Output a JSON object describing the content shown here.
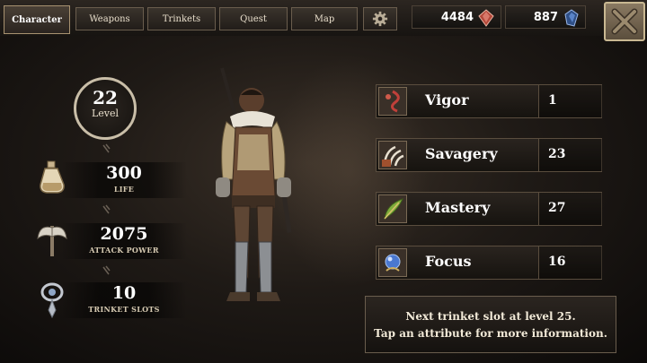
{
  "tabs": [
    {
      "label": "Character",
      "active": true
    },
    {
      "label": "Weapons",
      "active": false
    },
    {
      "label": "Trinkets",
      "active": false
    },
    {
      "label": "Quest",
      "active": false
    },
    {
      "label": "Map",
      "active": false
    }
  ],
  "settings_icon": "gear-icon",
  "currencies": [
    {
      "value": "4484",
      "icon": "red-gem-icon"
    },
    {
      "value": "887",
      "icon": "blue-gem-icon"
    }
  ],
  "close_icon": "close-x-icon",
  "level": {
    "value": "22",
    "label": "Level"
  },
  "stats": [
    {
      "value": "300",
      "label": "LIFE",
      "icon": "potion-flask-icon"
    },
    {
      "value": "2075",
      "label": "ATTACK POWER",
      "icon": "battle-axe-icon"
    },
    {
      "value": "10",
      "label": "TRINKET SLOTS",
      "icon": "trinket-amulet-icon"
    }
  ],
  "attributes": [
    {
      "name": "Vigor",
      "value": "1",
      "icon": "vigor-icon",
      "icon_color": "#c0403a"
    },
    {
      "name": "Savagery",
      "value": "23",
      "icon": "savagery-claw-icon",
      "icon_color": "#e8e0d0"
    },
    {
      "name": "Mastery",
      "value": "27",
      "icon": "mastery-feather-icon",
      "icon_color": "#7fae3c"
    },
    {
      "name": "Focus",
      "value": "16",
      "icon": "focus-orb-icon",
      "icon_color": "#4a78d0"
    }
  ],
  "info": {
    "line1": "Next trinket slot at level 25.",
    "line2": "Tap an attribute for more information."
  },
  "colors": {
    "panel": "#2a241f",
    "border": "#6a5d4d",
    "text": "#f2ead8",
    "close_button": "#7a6a52"
  }
}
